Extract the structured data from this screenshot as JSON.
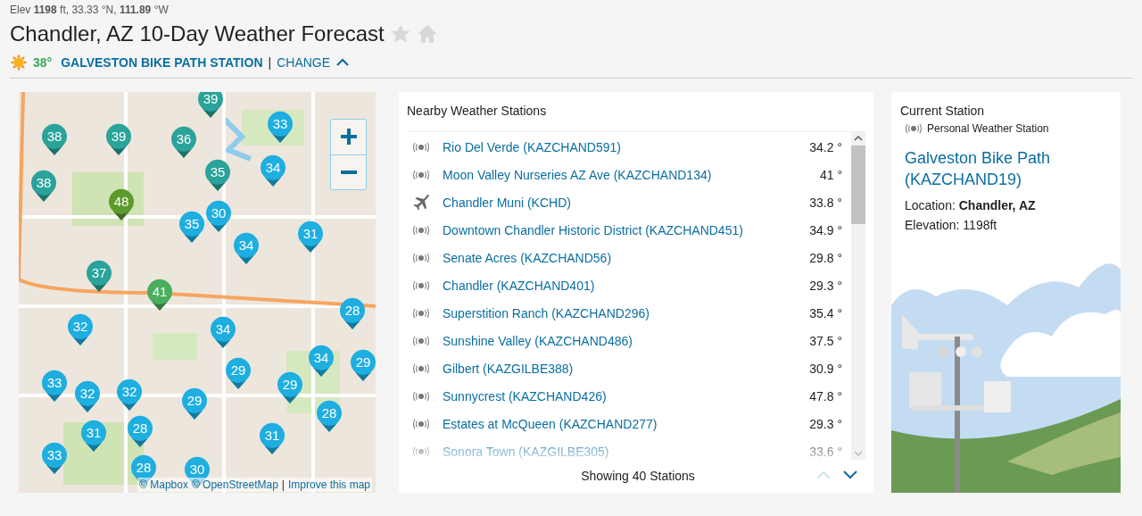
{
  "header": {
    "coordinates": "Elev **1198** ft, 33.33 °N, **111.89** °W",
    "title": "Chandler, AZ 10-Day Weather Forecast",
    "current_temp": "38°",
    "station_link": "GALVESTON BIKE PATH STATION",
    "separator": "|",
    "change": {
      "label": "CHANGE",
      "expanded": true
    }
  },
  "map": {
    "markers": [
      {
        "temp": "39",
        "color": "#2aa39a"
      },
      {
        "temp": "33",
        "color": "#1eaee0"
      },
      {
        "temp": "38",
        "color": "#2aa39a"
      },
      {
        "temp": "39",
        "color": "#2aa39a"
      },
      {
        "temp": "36",
        "color": "#2aa39a"
      },
      {
        "temp": "34",
        "color": "#1eaee0"
      },
      {
        "temp": "35",
        "color": "#2aa39a"
      },
      {
        "temp": "38",
        "color": "#2aa39a"
      },
      {
        "temp": "48",
        "color": "#5d9a2c"
      },
      {
        "temp": "30",
        "color": "#1eaee0"
      },
      {
        "temp": "35",
        "color": "#1eaee0"
      },
      {
        "temp": "34",
        "color": "#1eaee0"
      },
      {
        "temp": "31",
        "color": "#1eaee0"
      },
      {
        "temp": "37",
        "color": "#2aa39a"
      },
      {
        "temp": "41",
        "color": "#4aae5c"
      },
      {
        "temp": "28",
        "color": "#1eaee0"
      },
      {
        "temp": "32",
        "color": "#1eaee0"
      },
      {
        "temp": "34",
        "color": "#1eaee0"
      },
      {
        "temp": "34",
        "color": "#1eaee0"
      },
      {
        "temp": "29",
        "color": "#1eaee0"
      },
      {
        "temp": "29",
        "color": "#1eaee0"
      },
      {
        "temp": "29",
        "color": "#1eaee0"
      },
      {
        "temp": "33",
        "color": "#1eaee0"
      },
      {
        "temp": "32",
        "color": "#1eaee0"
      },
      {
        "temp": "32",
        "color": "#1eaee0"
      },
      {
        "temp": "29",
        "color": "#1eaee0"
      },
      {
        "temp": "28",
        "color": "#1eaee0"
      },
      {
        "temp": "31",
        "color": "#1eaee0"
      },
      {
        "temp": "28",
        "color": "#1eaee0"
      },
      {
        "temp": "31",
        "color": "#1eaee0"
      },
      {
        "temp": "33",
        "color": "#1eaee0"
      },
      {
        "temp": "28",
        "color": "#1eaee0"
      },
      {
        "temp": "30",
        "color": "#1eaee0"
      }
    ],
    "attribution": [
      {
        "label": "© Mapbox"
      },
      {
        "label": "© OpenStreetMap"
      },
      {
        "label": "|",
        "kind": "separator"
      },
      {
        "label": "Improve this map"
      }
    ]
  },
  "nearby": {
    "title": "Nearby Weather Stations",
    "stations": [
      {
        "name": "Rio Del Verde (KAZCHAND591)",
        "temp": "34.2 °",
        "kind": "pws"
      },
      {
        "name": "Moon Valley Nurseries AZ Ave (KAZCHAND134)",
        "temp": "41 °",
        "kind": "pws"
      },
      {
        "name": "Chandler Muni (KCHD)",
        "temp": "33.8 °",
        "kind": "airport"
      },
      {
        "name": "Downtown Chandler Historic District (KAZCHAND451)",
        "temp": "34.9 °",
        "kind": "pws"
      },
      {
        "name": "Senate Acres (KAZCHAND56)",
        "temp": "29.8 °",
        "kind": "pws"
      },
      {
        "name": "Chandler (KAZCHAND401)",
        "temp": "29.3 °",
        "kind": "pws"
      },
      {
        "name": "Superstition Ranch (KAZCHAND296)",
        "temp": "35.4 °",
        "kind": "pws"
      },
      {
        "name": "Sunshine Valley (KAZCHAND486)",
        "temp": "37.5 °",
        "kind": "pws"
      },
      {
        "name": "Gilbert (KAZGILBE388)",
        "temp": "30.9 °",
        "kind": "pws"
      },
      {
        "name": "Sunnycrest (KAZCHAND426)",
        "temp": "47.8 °",
        "kind": "pws"
      },
      {
        "name": "Estates at McQueen (KAZCHAND277)",
        "temp": "29.3 °",
        "kind": "pws"
      },
      {
        "name": "Sonora Town (KAZGILBE305)",
        "temp": "33.6 °",
        "kind": "pws"
      }
    ],
    "footer": "Showing 40 Stations",
    "pager": {
      "up_disabled": true,
      "down_disabled": false
    }
  },
  "current_station": {
    "title": "Current Station",
    "type": "Personal Weather Station",
    "name": "Galveston Bike Path (KAZCHAND19)",
    "location": "Location: **Chandler, AZ**",
    "elevation": "Elevation: 1198ft"
  }
}
